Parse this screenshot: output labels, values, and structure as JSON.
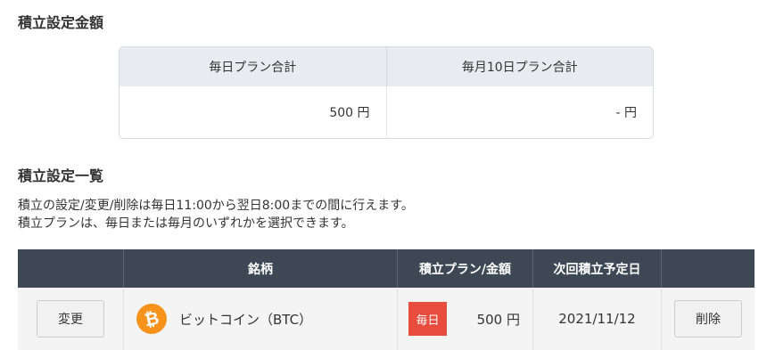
{
  "settings_total": {
    "title": "積立設定金額",
    "headers": [
      "毎日プラン合計",
      "毎月10日プラン合計"
    ],
    "values": [
      "500 円",
      "- 円"
    ]
  },
  "settings_list": {
    "title": "積立設定一覧",
    "description_lines": [
      "積立の設定/変更/削除は毎日11:00から翌日8:00までの間に行えます。",
      "積立プランは、毎日または毎月のいずれかを選択できます。"
    ],
    "columns": [
      "",
      "銘柄",
      "積立プラン/金額",
      "次回積立予定日",
      ""
    ],
    "rows": [
      {
        "change_label": "変更",
        "icon": "bitcoin-icon",
        "icon_glyph": "₿",
        "coin_name": "ビットコイン（BTC）",
        "plan_badge": "毎日",
        "amount": "500 円",
        "next_date": "2021/11/12",
        "delete_label": "削除"
      }
    ]
  },
  "colors": {
    "header_bg": "#3e4855",
    "badge_red": "#e84c3d",
    "bitcoin_orange": "#f7931a",
    "summary_header_bg": "#e8ecf1"
  }
}
